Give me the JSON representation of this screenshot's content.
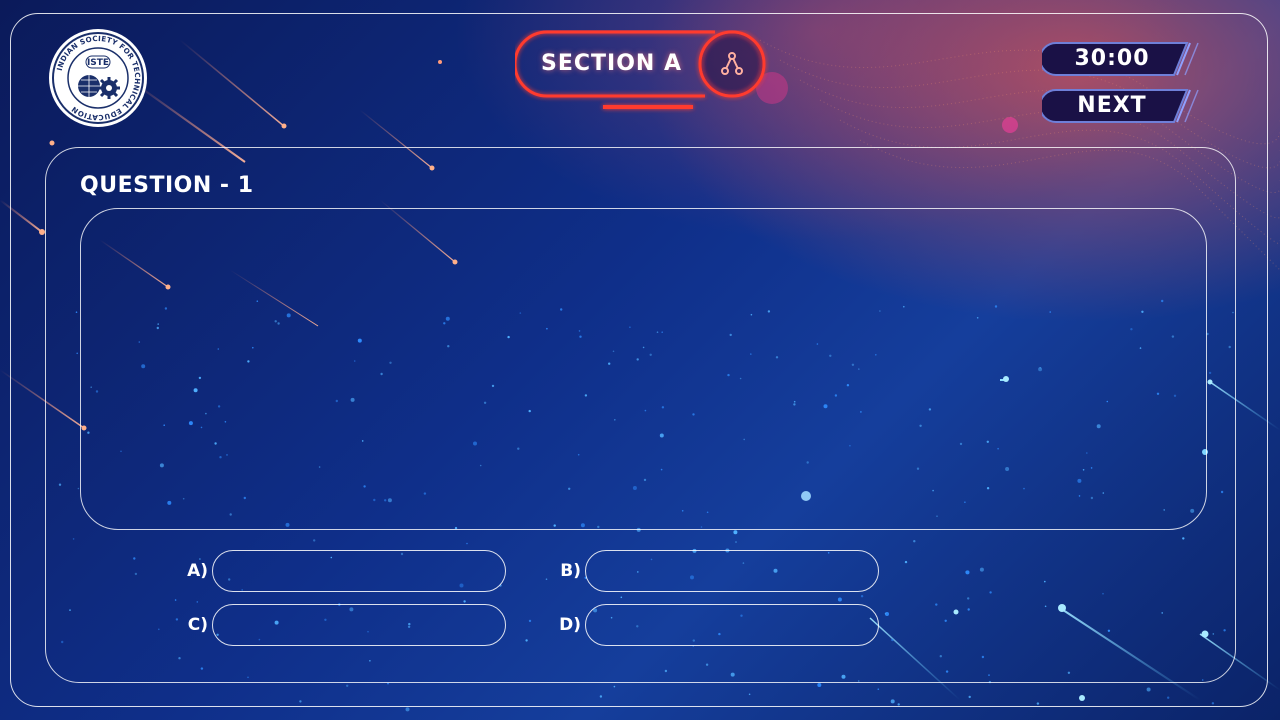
{
  "logo": {
    "center_text": "ISTE",
    "ring_text": "INDIAN SOCIETY FOR TECHNICAL EDUCATION"
  },
  "header": {
    "section_label": "SECTION A",
    "section_icon": "share-nodes-icon",
    "timer": "30:00",
    "next_label": "NEXT"
  },
  "question": {
    "title": "QUESTION - 1",
    "text": ""
  },
  "options": [
    {
      "label": "A)",
      "text": ""
    },
    {
      "label": "B)",
      "text": ""
    },
    {
      "label": "C)",
      "text": ""
    },
    {
      "label": "D)",
      "text": ""
    }
  ],
  "colors": {
    "neon_red": "#ff3a2e",
    "hud_fill": "#1a1146",
    "frame": "#ffffff"
  }
}
